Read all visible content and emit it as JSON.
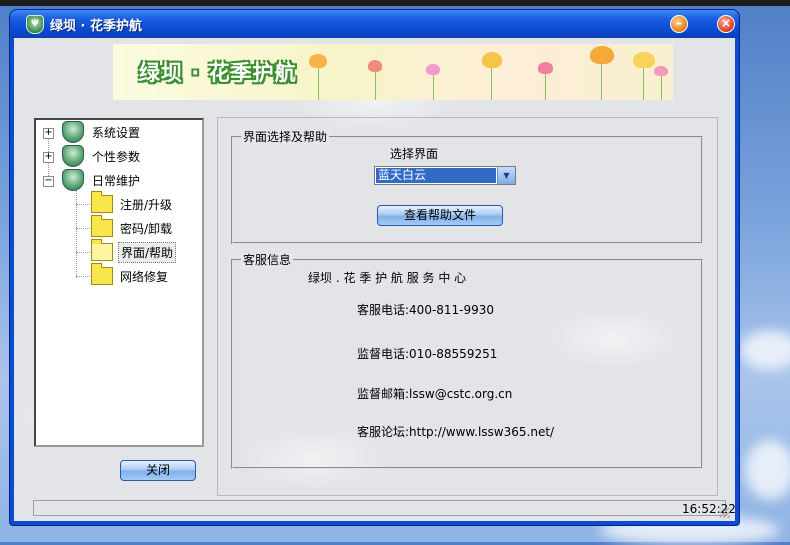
{
  "window": {
    "title": "绿坝 · 花季护航",
    "minimize_icon": "minimize-icon",
    "close_icon": "close-icon"
  },
  "banner": {
    "text": "绿坝 · 花季护航"
  },
  "tree": {
    "items": [
      {
        "label": "系统设置",
        "icon": "shield-icon",
        "expander": "+"
      },
      {
        "label": "个性参数",
        "icon": "shield-icon",
        "expander": "+"
      },
      {
        "label": "日常维护",
        "icon": "shield-icon",
        "expander": "−"
      },
      {
        "label": "注册/升级",
        "icon": "folder-icon"
      },
      {
        "label": "密码/卸载",
        "icon": "folder-icon"
      },
      {
        "label": "界面/帮助",
        "icon": "folder-open-icon",
        "selected": true
      },
      {
        "label": "网络修复",
        "icon": "folder-icon"
      }
    ]
  },
  "buttons": {
    "close_label": "关闭",
    "help_label": "查看帮助文件"
  },
  "ui_group": {
    "title": "界面选择及帮助",
    "select_label": "选择界面",
    "select_value": "蓝天白云"
  },
  "service_group": {
    "title": "客服信息",
    "center_name": "绿坝 . 花 季 护 航 服 务 中 心",
    "phone": "客服电话:400-811-9930",
    "supervise_phone": "监督电话:010-88559251",
    "supervise_email": "监督邮箱:lssw@cstc.org.cn",
    "forum": "客服论坛:http://www.lssw365.net/"
  },
  "status": {
    "time": "16:52:22"
  },
  "colors": {
    "title_bar": "#0a4bd2",
    "selection": "#316ac5",
    "banner_green": "#3b8e2e"
  }
}
